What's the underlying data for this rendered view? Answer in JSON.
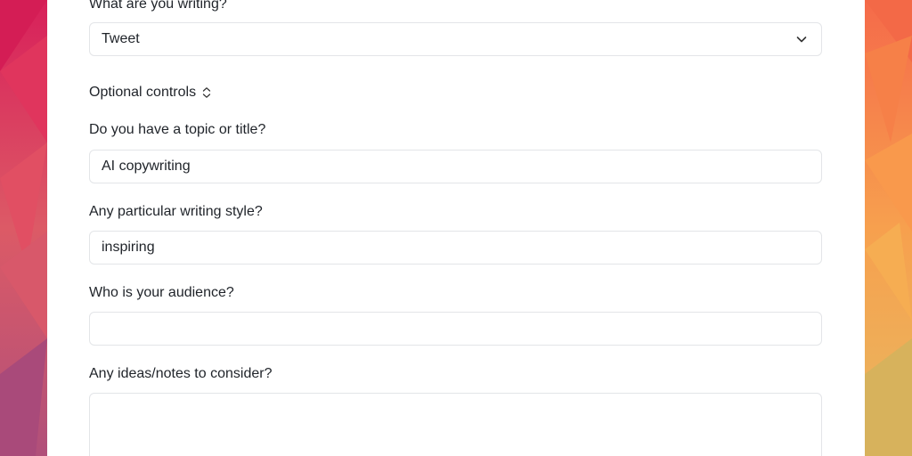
{
  "form": {
    "type_label": "What are you writing?",
    "type_select": {
      "value": "Tweet"
    },
    "optional_controls_label": "Optional controls",
    "topic_label": "Do you have a topic or title?",
    "topic_value": "AI copywriting",
    "style_label": "Any particular writing style?",
    "style_value": "inspiring",
    "audience_label": "Who is your audience?",
    "audience_value": "",
    "notes_label": "Any ideas/notes to consider?",
    "notes_value": ""
  },
  "icons": {
    "select_chevron": "chevron-down-icon",
    "optional_toggle": "chevron-up-down-icon"
  },
  "colors": {
    "background_left": "#d81f5a",
    "background_right": "#f59a4a",
    "panel": "#ffffff",
    "field_border": "#e3e5e8",
    "text": "#1f2329"
  }
}
